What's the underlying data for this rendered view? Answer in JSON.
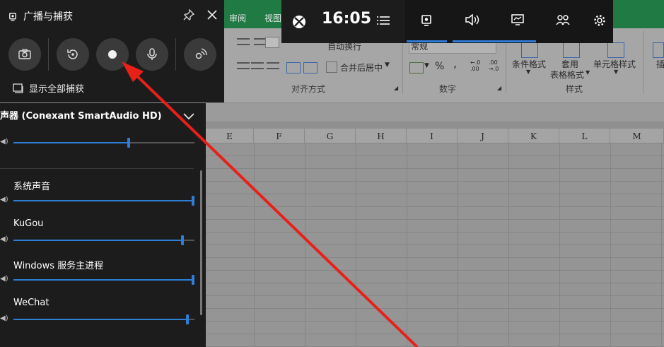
{
  "excel": {
    "tabs": [
      "审阅",
      "视图"
    ],
    "ribbon": {
      "wrap_text": "自动换行",
      "merge_center": "合并后居中",
      "number_format": "常规",
      "percent": "%",
      "comma": ",",
      "conditional_format": "条件格式",
      "table_format_1": "套用",
      "table_format_2": "表格格式",
      "cell_styles": "单元格样式",
      "insert": "插",
      "group_align": "对齐方式",
      "group_number": "数字",
      "group_styles": "样式"
    },
    "columns": [
      "E",
      "F",
      "G",
      "H",
      "I",
      "J",
      "K",
      "L",
      "M"
    ]
  },
  "gamebar": {
    "time": "16:05",
    "icons": [
      "xbox-icon",
      "menu-icon",
      "capture-widget-icon",
      "audio-icon",
      "performance-icon",
      "social-icon",
      "settings-icon"
    ],
    "accent": "#2d7bd6"
  },
  "capture": {
    "title": "广播与捕获",
    "show_all": "显示全部捕获",
    "buttons": [
      "screenshot",
      "record-last",
      "start-recording",
      "microphone",
      "broadcast"
    ]
  },
  "audio": {
    "device": "声器 (Conexant SmartAudio HD)",
    "master_level": 0.64,
    "apps": [
      {
        "name": "系统声音",
        "level": 1.0
      },
      {
        "name": "KuGou",
        "level": 0.94
      },
      {
        "name": "Windows 服务主进程",
        "level": 1.0
      },
      {
        "name": "WeChat",
        "level": 0.97
      }
    ]
  }
}
